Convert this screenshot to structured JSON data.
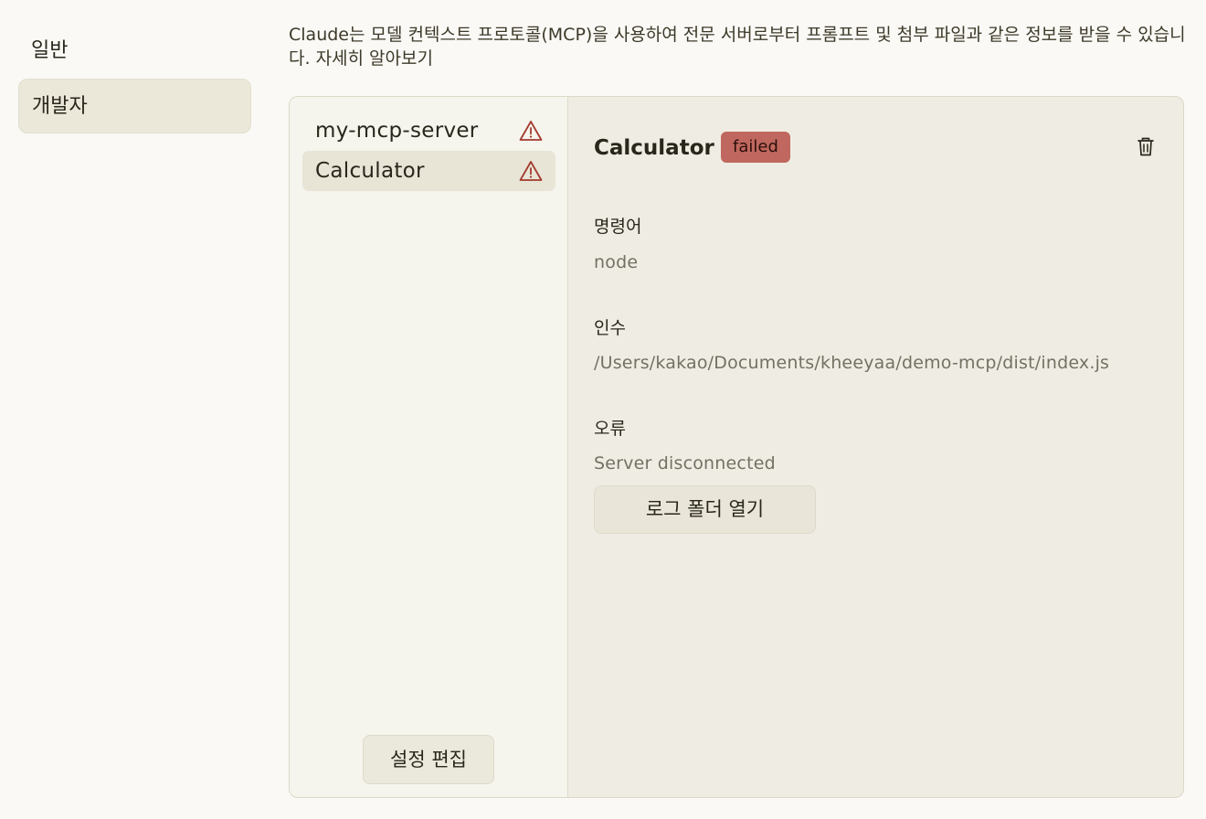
{
  "nav": {
    "items": [
      {
        "label": "일반",
        "active": false
      },
      {
        "label": "개발자",
        "active": true
      }
    ]
  },
  "intro": {
    "text": "Claude는 모델 컨텍스트 프로토콜(MCP)을 사용하여 전문 서버로부터 프롬프트 및 첨부 파일과 같은 정보를 받을 수 있습니다.",
    "link": "자세히 알아보기"
  },
  "servers": {
    "items": [
      {
        "name": "my-mcp-server",
        "icon": "warning-icon",
        "active": false
      },
      {
        "name": "Calculator",
        "icon": "warning-icon",
        "active": true
      }
    ],
    "edit_config_label": "설정 편집"
  },
  "detail": {
    "title": "Calculator",
    "status": "failed",
    "command_label": "명령어",
    "command_value": "node",
    "args_label": "인수",
    "args_value": "/Users/kakao/Documents/kheeyaa/demo-mcp/dist/index.js",
    "error_label": "오류",
    "error_value": "Server disconnected",
    "open_logs_label": "로그 폴더 열기"
  },
  "colors": {
    "background": "#faf9f5",
    "panel": "#efede3",
    "status_failed": "#c0685f",
    "warning": "#a3392e"
  }
}
